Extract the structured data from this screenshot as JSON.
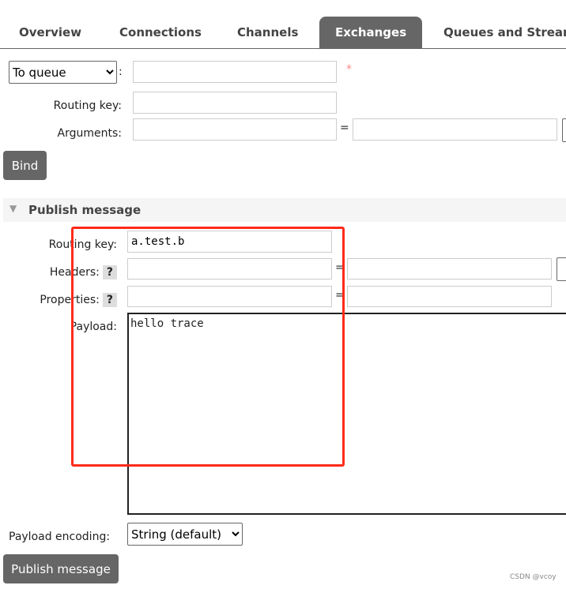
{
  "tabs": [
    "Overview",
    "Connections",
    "Channels",
    "Exchanges",
    "Queues and Streams"
  ],
  "bind": {
    "destination_type": "To queue",
    "colon": ":",
    "required": "*",
    "routing_key_label": "Routing key:",
    "arguments_label": "Arguments:",
    "equals": "=",
    "bind_button": "Bind"
  },
  "publish": {
    "title": "Publish message",
    "routing_key_label": "Routing key:",
    "routing_key_value": "a.test.b",
    "headers_label": "Headers:",
    "properties_label": "Properties:",
    "help": "?",
    "equals": "=",
    "payload_label": "Payload:",
    "payload_value": "hello trace",
    "encoding_label": "Payload encoding:",
    "encoding_value": "String (default)",
    "publish_button": "Publish message"
  },
  "watermark": "CSDN @vcoy",
  "highlight_color": "#ff2a1a"
}
